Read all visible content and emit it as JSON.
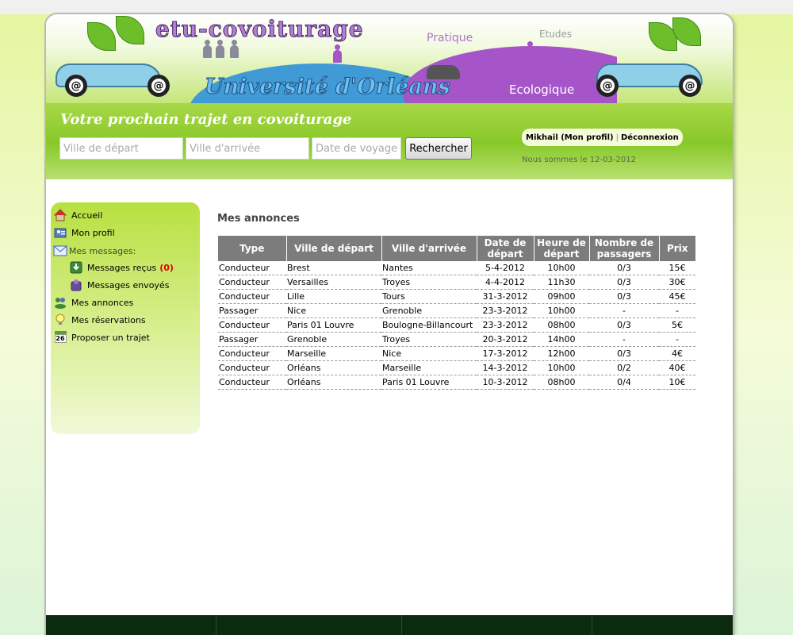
{
  "header": {
    "site_title": "etu-covoiturage",
    "subtitle": "Université d'Orléans",
    "banner_words": [
      "Pratique",
      "Etudes",
      "Ecologique"
    ],
    "wheel_glyph": "@"
  },
  "search": {
    "title": "Votre prochain trajet en covoiturage",
    "departure_placeholder": "Ville de départ",
    "arrival_placeholder": "Ville d'arrivée",
    "date_placeholder": "Date de voyage",
    "button_label": "Rechercher"
  },
  "user": {
    "profile_link": "Mikhail (Mon profil)",
    "logout_link": "Déconnexion",
    "today": "Nous sommes le 12-03-2012"
  },
  "sidebar": {
    "home": "Accueil",
    "profile": "Mon profil",
    "messages_group": "Mes messages:",
    "received": "Messages reçus",
    "received_count": "(0)",
    "sent": "Messages envoyés",
    "ads": "Mes annonces",
    "bookings": "Mes réservations",
    "propose": "Proposer un trajet",
    "calendar_day": "26"
  },
  "main": {
    "heading": "Mes annonces",
    "columns": [
      "Type",
      "Ville de départ",
      "Ville d'arrivée",
      "Date de départ",
      "Heure de départ",
      "Nombre de passagers",
      "Prix"
    ],
    "rows": [
      [
        "Conducteur",
        "Brest",
        "Nantes",
        "5-4-2012",
        "10h00",
        "0/3",
        "15€"
      ],
      [
        "Conducteur",
        "Versailles",
        "Troyes",
        "4-4-2012",
        "11h30",
        "0/3",
        "30€"
      ],
      [
        "Conducteur",
        "Lille",
        "Tours",
        "31-3-2012",
        "09h00",
        "0/3",
        "45€"
      ],
      [
        "Passager",
        "Nice",
        "Grenoble",
        "23-3-2012",
        "10h00",
        "-",
        "-"
      ],
      [
        "Conducteur",
        "Paris 01 Louvre",
        "Boulogne-Billancourt",
        "23-3-2012",
        "08h00",
        "0/3",
        "5€"
      ],
      [
        "Passager",
        "Grenoble",
        "Troyes",
        "20-3-2012",
        "14h00",
        "-",
        "-"
      ],
      [
        "Conducteur",
        "Marseille",
        "Nice",
        "17-3-2012",
        "12h00",
        "0/3",
        "4€"
      ],
      [
        "Conducteur",
        "Orléans",
        "Marseille",
        "14-3-2012",
        "10h00",
        "0/2",
        "40€"
      ],
      [
        "Conducteur",
        "Orléans",
        "Paris 01 Louvre",
        "10-3-2012",
        "08h00",
        "0/4",
        "10€"
      ]
    ]
  },
  "colors": {
    "accent_green": "#88c828",
    "purple": "#a555c8",
    "table_header": "#7c7c7c",
    "count_red": "#e00000"
  }
}
